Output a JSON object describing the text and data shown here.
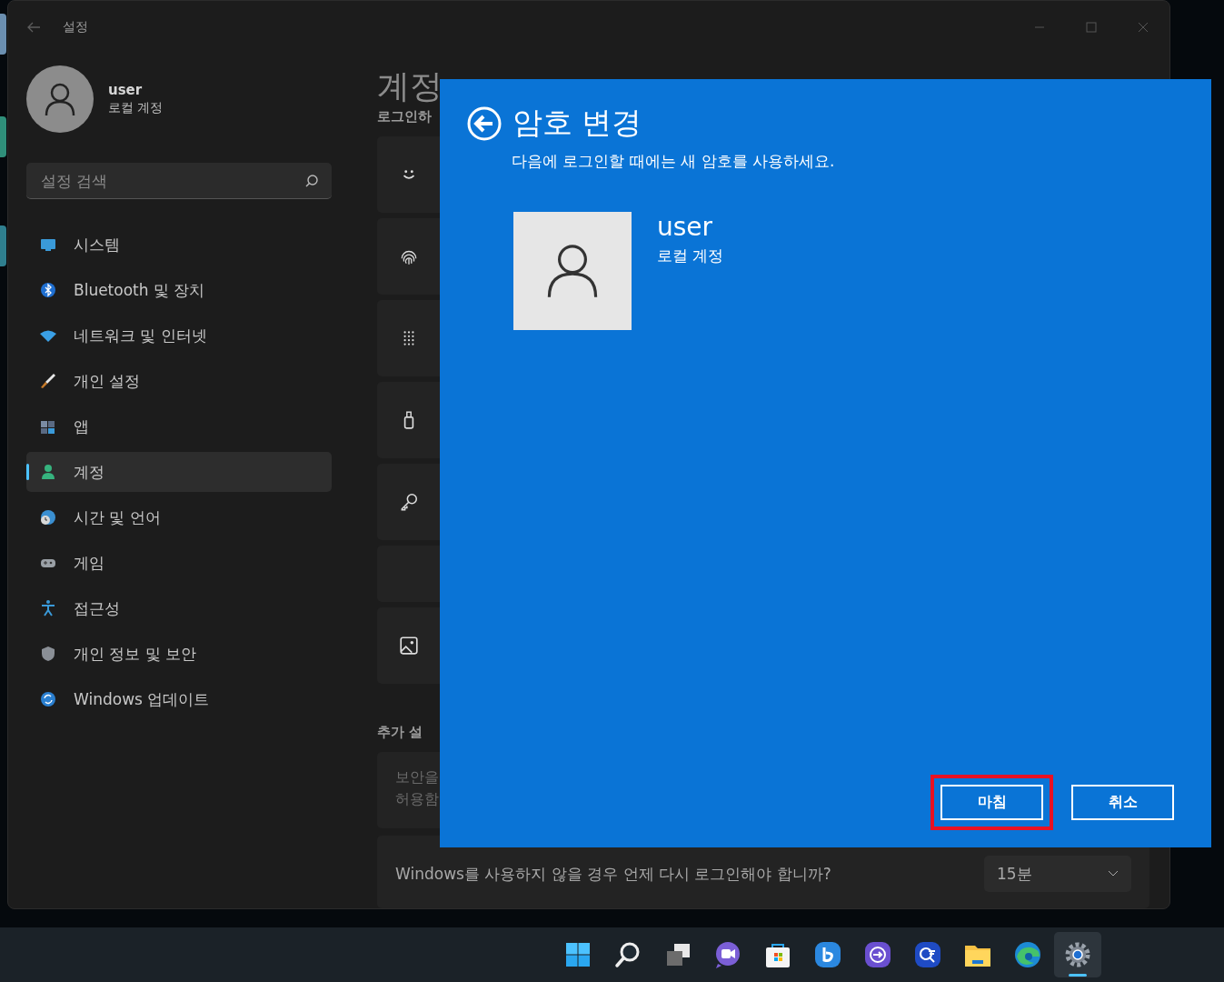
{
  "window": {
    "title": "설정"
  },
  "profile": {
    "name": "user",
    "account_type": "로컬 계정"
  },
  "search": {
    "placeholder": "설정 검색"
  },
  "nav": [
    {
      "label": "시스템",
      "selected": false
    },
    {
      "label": "Bluetooth 및 장치",
      "selected": false
    },
    {
      "label": "네트워크 및 인터넷",
      "selected": false
    },
    {
      "label": "개인 설정",
      "selected": false
    },
    {
      "label": "앱",
      "selected": false
    },
    {
      "label": "계정",
      "selected": true
    },
    {
      "label": "시간 및 언어",
      "selected": false
    },
    {
      "label": "게임",
      "selected": false
    },
    {
      "label": "접근성",
      "selected": false
    },
    {
      "label": "개인 정보 및 보안",
      "selected": false
    },
    {
      "label": "Windows 업데이트",
      "selected": false
    }
  ],
  "page": {
    "title": "계정",
    "section_1": "로그인하",
    "section_2": "추가 설",
    "extra_card_lines": [
      "보안을",
      "허용함"
    ],
    "signin_question": "Windows를 사용하지 않을 경우 언제 다시 로그인해야 합니까?",
    "timeout": {
      "value": "15분"
    }
  },
  "dialog": {
    "title": "암호 변경",
    "subtitle": "다음에 로그인할 때에는 새 암호를 사용하세요.",
    "user": {
      "name": "user",
      "account_type": "로컬 계정"
    },
    "buttons": [
      {
        "label": "마침",
        "highlighted": true
      },
      {
        "label": "취소",
        "highlighted": false
      }
    ]
  },
  "taskbar": {
    "items": [
      {
        "selected": false
      },
      {
        "selected": false
      },
      {
        "selected": false
      },
      {
        "selected": false
      },
      {
        "selected": false
      },
      {
        "selected": false
      },
      {
        "selected": false
      },
      {
        "selected": false
      },
      {
        "selected": false
      },
      {
        "selected": false
      },
      {
        "selected": true
      }
    ]
  }
}
